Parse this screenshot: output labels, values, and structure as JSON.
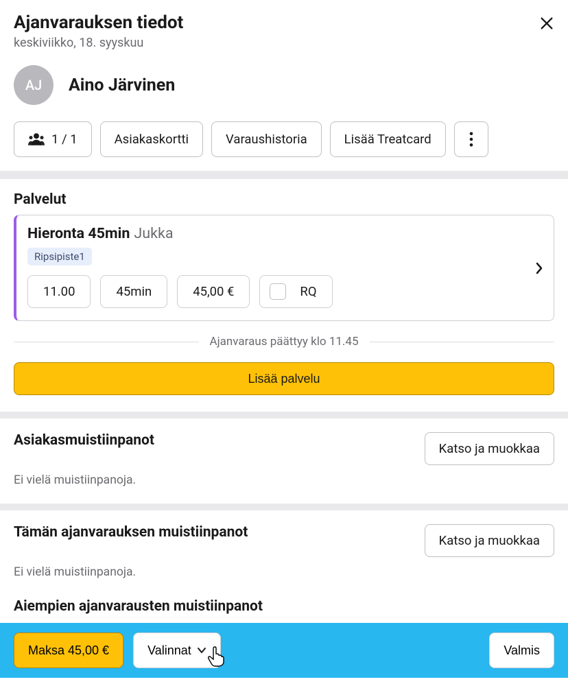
{
  "header": {
    "title": "Ajanvarauksen tiedot",
    "subtitle": "keskiviikko, 18. syyskuu"
  },
  "customer": {
    "initials": "AJ",
    "name": "Aino Järvinen"
  },
  "actions": {
    "people_count": "1 / 1",
    "customer_card": "Asiakaskortti",
    "history": "Varaushistoria",
    "add_treatcard": "Lisää Treatcard"
  },
  "services": {
    "heading": "Palvelut",
    "items": [
      {
        "name": "Hieronta 45min",
        "staff": "Jukka",
        "tag": "Ripsipiste1",
        "time": "11.00",
        "duration": "45min",
        "price": "45,00 €",
        "rq_label": "RQ"
      }
    ],
    "ends_text": "Ajanvaraus päättyy klo 11.45",
    "add_button": "Lisää palvelu"
  },
  "client_notes": {
    "heading": "Asiakasmuistiinpanot",
    "view_edit": "Katso ja muokkaa",
    "empty": "Ei vielä muistiinpanoja."
  },
  "booking_notes": {
    "heading": "Tämän ajanvarauksen muistiinpanot",
    "view_edit": "Katso ja muokkaa",
    "empty": "Ei vielä muistiinpanoja.",
    "prev_heading": "Aiempien ajanvarausten muistiinpanot"
  },
  "footer": {
    "pay": "Maksa 45,00 €",
    "options": "Valinnat",
    "done": "Valmis"
  }
}
